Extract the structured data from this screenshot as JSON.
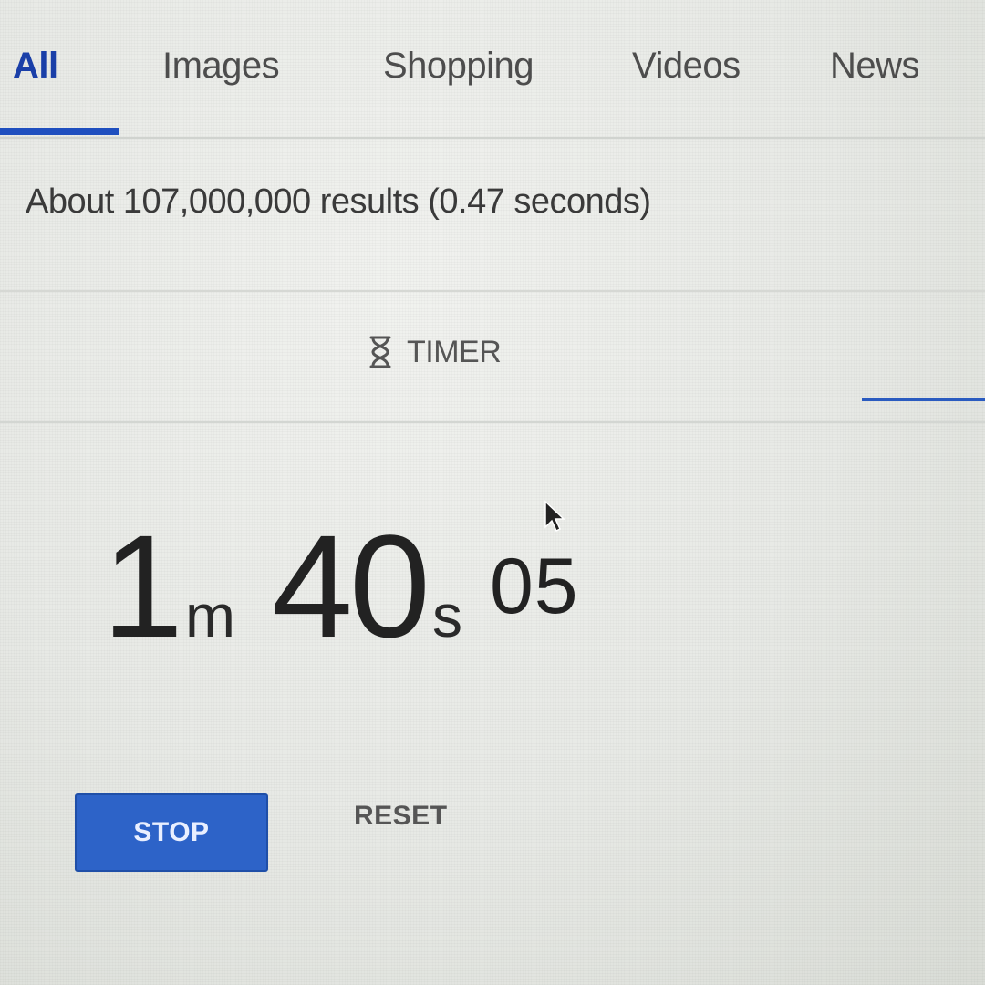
{
  "tabs": {
    "items": [
      {
        "label": "All",
        "active": true
      },
      {
        "label": "Images",
        "active": false
      },
      {
        "label": "Shopping",
        "active": false
      },
      {
        "label": "Videos",
        "active": false
      },
      {
        "label": "News",
        "active": false
      }
    ]
  },
  "results": {
    "stats": "About 107,000,000 results (0.47 seconds)"
  },
  "timer": {
    "tab_icon": "hourglass-icon",
    "tab_label": "TIMER",
    "minutes": "1",
    "minutes_unit": "m",
    "seconds": "40",
    "seconds_unit": "s",
    "hundredths": "05",
    "stop_label": "STOP",
    "reset_label": "RESET"
  },
  "colors": {
    "accent": "#1f4fbf",
    "active_tab_text": "#1a3fa8",
    "stop_button": "#2d63c8"
  },
  "cursor": "arrow-cursor-icon"
}
